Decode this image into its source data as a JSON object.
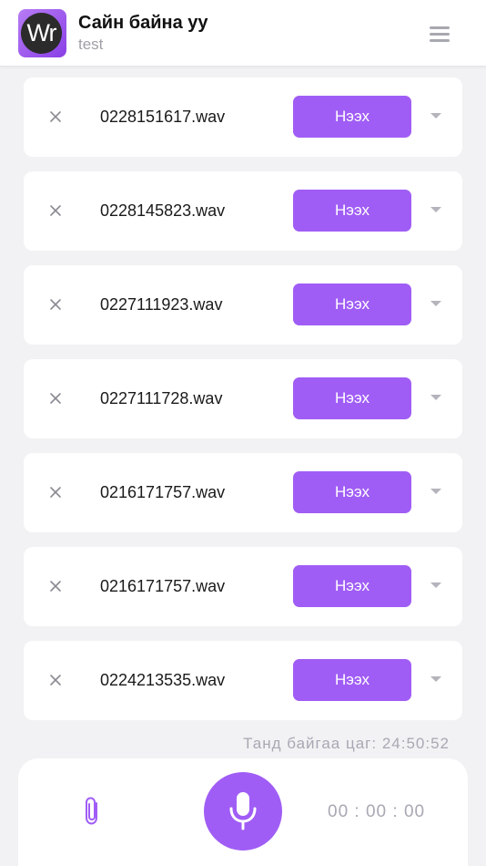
{
  "header": {
    "logo_text": "Wr",
    "title": "Сайн байна уу",
    "subtitle": "test"
  },
  "files": [
    {
      "name": "0228151617.wav",
      "action_label": "Нээх"
    },
    {
      "name": "0228145823.wav",
      "action_label": "Нээх"
    },
    {
      "name": "0227111923.wav",
      "action_label": "Нээх"
    },
    {
      "name": "0227111728.wav",
      "action_label": "Нээх"
    },
    {
      "name": "0216171757.wav",
      "action_label": "Нээх"
    },
    {
      "name": "0216171757.wav",
      "action_label": "Нээх"
    },
    {
      "name": "0224213535.wav",
      "action_label": "Нээх"
    }
  ],
  "remaining_time": "Танд байгаа цаг: 24:50:52",
  "recorder": {
    "timer": "00 : 00 : 00"
  },
  "colors": {
    "accent": "#a05df5",
    "background": "#f2f2f4",
    "muted_text": "#a8a8b4"
  },
  "icons": {
    "menu": "hamburger-icon",
    "remove": "close-icon",
    "expand": "chevron-down-icon",
    "attach": "paperclip-icon",
    "record": "microphone-icon"
  }
}
